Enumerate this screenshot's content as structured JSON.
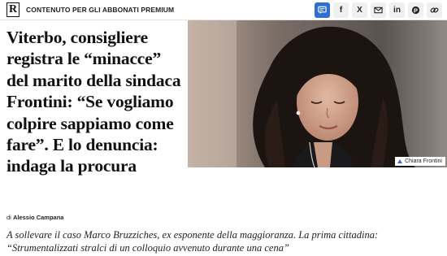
{
  "header": {
    "logo_letter": "R",
    "premium_label": "CONTENUTO PER GLI ABBONATI PREMIUM",
    "share_buttons": [
      {
        "icon": "comment-icon",
        "label": ""
      },
      {
        "icon": "facebook-icon",
        "label": "f"
      },
      {
        "icon": "x-icon",
        "label": "X"
      },
      {
        "icon": "mail-icon",
        "label": ""
      },
      {
        "icon": "linkedin-icon",
        "label": "in"
      },
      {
        "icon": "pinterest-icon",
        "label": "P"
      },
      {
        "icon": "link-icon",
        "label": ""
      }
    ],
    "accent_color": "#2f6fd0"
  },
  "article": {
    "headline": "Viterbo, consigliere registra le “minacce” del marito della sindaca Frontini: “Se vogliamo colpire sappiamo come fare”. E lo denuncia: indaga la procura",
    "photo_caption": "Chiara Frontini",
    "byline_prefix": "di",
    "author": "Alessio Campana",
    "summary": "A sollevare il caso Marco Bruzziches, ex esponente della maggioranza. La prima cittadina: “Strumentalizzati stralci di un colloquio avvenuto durante una cena”"
  }
}
